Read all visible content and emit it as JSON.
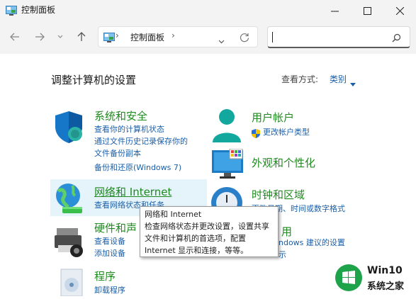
{
  "window": {
    "title": "控制面板"
  },
  "address": {
    "path": "控制面板"
  },
  "search": {
    "placeholder": ""
  },
  "main": {
    "heading": "调整计算机的设置",
    "view_by_label": "查看方式:",
    "view_by_value": "类别"
  },
  "categories": {
    "system": {
      "title": "系统和安全",
      "links": [
        "查看你的计算机状态",
        "通过文件历史记录保存你的",
        "文件备份副本",
        "备份和还原(Windows 7)"
      ]
    },
    "network": {
      "title": "网络和 Internet",
      "links": [
        "查看网络状态和任务"
      ]
    },
    "hardware": {
      "title": "硬件和声",
      "links": [
        "查看设备",
        "添加设备"
      ]
    },
    "programs": {
      "title": "程序",
      "links": [
        "卸载程序"
      ]
    },
    "user": {
      "title": "用户帐户",
      "links": [
        "更改帐户类型"
      ]
    },
    "appearance": {
      "title": "外观和个性化",
      "links": []
    },
    "clock": {
      "title": "时钟和区域",
      "links": [
        "更改日期、时间或数字格式"
      ]
    },
    "ease": {
      "title": "用",
      "links": [
        "ndows 建议的设置",
        "示"
      ]
    }
  },
  "tooltip": {
    "lines": [
      "网络和 Internet",
      "检查网络状态并更改设置，设置共享",
      "文件和计算机的首选项，配置",
      "Internet 显示和连接，等等。"
    ]
  },
  "watermark": {
    "title": "Win10",
    "subtitle": "系统之家"
  }
}
